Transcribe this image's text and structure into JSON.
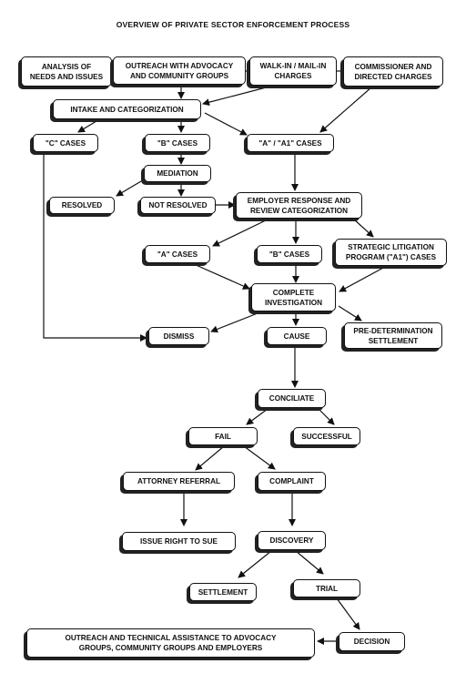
{
  "title": "OVERVIEW OF PRIVATE SECTOR ENFORCEMENT PROCESS",
  "nodes": {
    "analysis": "ANALYSIS OF\nNEEDS AND ISSUES",
    "outreach": "OUTREACH WITH ADVOCACY\nAND COMMUNITY GROUPS",
    "walkin": "WALK-IN / MAIL-IN\nCHARGES",
    "commissioner": "COMMISSIONER AND\nDIRECTED CHARGES",
    "intake": "INTAKE AND CATEGORIZATION",
    "c_cases": "\"C\" CASES",
    "b_cases": "\"B\" CASES",
    "a_a1_cases": "\"A\" / \"A1\"  CASES",
    "mediation": "MEDIATION",
    "resolved": "RESOLVED",
    "not_resolved": "NOT RESOLVED",
    "employer_response": "EMPLOYER RESPONSE AND\nREVIEW CATEGORIZATION",
    "a_cases": "\"A\" CASES",
    "b_cases2": "\"B\" CASES",
    "strategic": "STRATEGIC LITIGATION\nPROGRAM (\"A1\") CASES",
    "investigation": "COMPLETE\nINVESTIGATION",
    "dismiss": "DISMISS",
    "cause": "CAUSE",
    "predetermination": "PRE-DETERMINATION\nSETTLEMENT",
    "conciliate": "CONCILIATE",
    "fail": "FAIL",
    "successful": "SUCCESSFUL",
    "attorney": "ATTORNEY REFERRAL",
    "complaint": "COMPLAINT",
    "right_to_sue": "ISSUE RIGHT TO SUE",
    "discovery": "DISCOVERY",
    "settlement": "SETTLEMENT",
    "trial": "TRIAL",
    "decision": "DECISION",
    "outreach_ta": "OUTREACH AND TECHNICAL ASSISTANCE TO ADVOCACY\nGROUPS, COMMUNITY GROUPS AND EMPLOYERS"
  },
  "edges": [
    [
      "analysis",
      "outreach"
    ],
    [
      "outreach",
      "walkin"
    ],
    [
      "walkin",
      "commissioner"
    ],
    [
      "outreach",
      "intake"
    ],
    [
      "walkin",
      "intake"
    ],
    [
      "commissioner",
      "a_a1_cases"
    ],
    [
      "intake",
      "c_cases"
    ],
    [
      "intake",
      "b_cases"
    ],
    [
      "intake",
      "a_a1_cases"
    ],
    [
      "b_cases",
      "mediation"
    ],
    [
      "mediation",
      "resolved"
    ],
    [
      "mediation",
      "not_resolved"
    ],
    [
      "not_resolved",
      "employer_response"
    ],
    [
      "a_a1_cases",
      "employer_response"
    ],
    [
      "employer_response",
      "a_cases"
    ],
    [
      "employer_response",
      "b_cases2"
    ],
    [
      "employer_response",
      "strategic"
    ],
    [
      "a_cases",
      "investigation"
    ],
    [
      "b_cases2",
      "investigation"
    ],
    [
      "strategic",
      "investigation"
    ],
    [
      "investigation",
      "dismiss"
    ],
    [
      "investigation",
      "cause"
    ],
    [
      "investigation",
      "predetermination"
    ],
    [
      "c_cases",
      "dismiss"
    ],
    [
      "cause",
      "conciliate"
    ],
    [
      "conciliate",
      "fail"
    ],
    [
      "conciliate",
      "successful"
    ],
    [
      "fail",
      "attorney"
    ],
    [
      "fail",
      "complaint"
    ],
    [
      "attorney",
      "right_to_sue"
    ],
    [
      "complaint",
      "discovery"
    ],
    [
      "discovery",
      "settlement"
    ],
    [
      "discovery",
      "trial"
    ],
    [
      "trial",
      "decision"
    ],
    [
      "decision",
      "outreach_ta"
    ]
  ]
}
